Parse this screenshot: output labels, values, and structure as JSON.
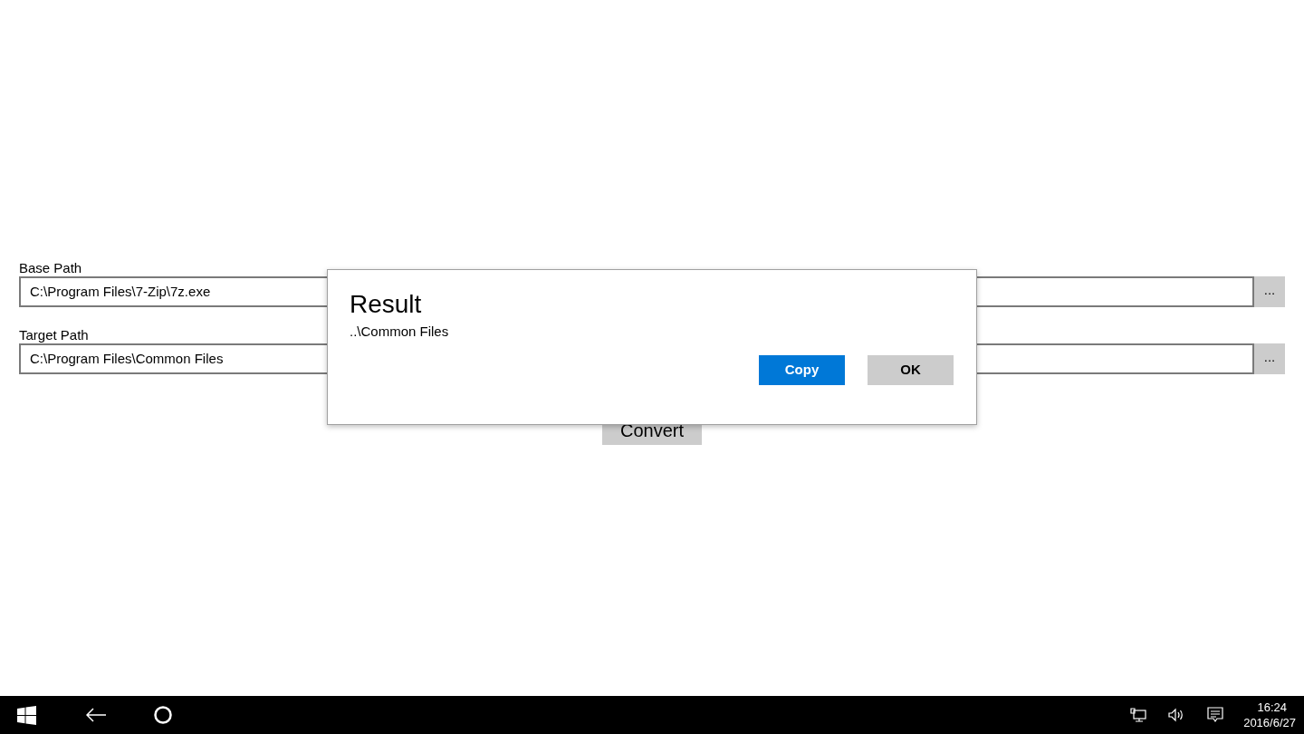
{
  "form": {
    "fields": [
      {
        "label": "Base Path",
        "value": "C:\\Program Files\\7-Zip\\7z.exe",
        "browse": "..."
      },
      {
        "label": "Target Path",
        "value": "C:\\Program Files\\Common Files",
        "browse": "..."
      }
    ],
    "action": "Convert"
  },
  "dialog": {
    "title": "Result",
    "message": "..\\Common Files",
    "buttons": [
      {
        "label": "Copy",
        "kind": "primary"
      },
      {
        "label": "OK",
        "kind": "secondary"
      }
    ]
  },
  "taskbar": {
    "time": "16:24",
    "date": "2016/6/27"
  }
}
